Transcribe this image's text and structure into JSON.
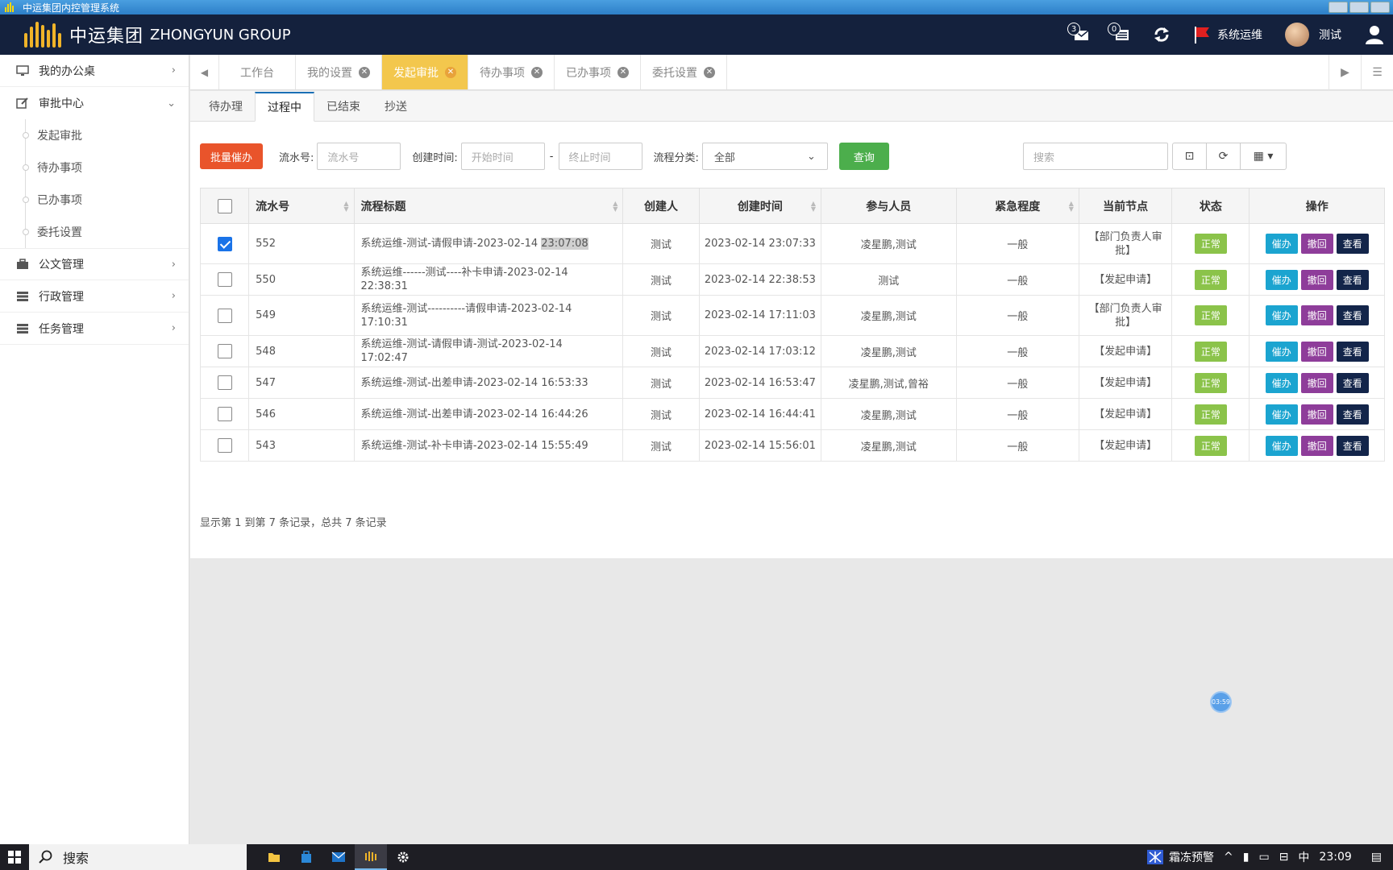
{
  "window": {
    "title": "中运集团内控管理系统"
  },
  "header": {
    "brand_cn": "中运集团",
    "brand_en": "ZHONGYUN GROUP",
    "msg_count": "3",
    "todo_count": "0",
    "role": "系统运维",
    "user": "测试"
  },
  "sidebar": {
    "items": [
      {
        "label": "我的办公桌"
      },
      {
        "label": "审批中心"
      },
      {
        "label": "公文管理"
      },
      {
        "label": "行政管理"
      },
      {
        "label": "任务管理"
      }
    ],
    "sub": [
      {
        "label": "发起审批"
      },
      {
        "label": "待办事项"
      },
      {
        "label": "已办事项"
      },
      {
        "label": "委托设置"
      }
    ]
  },
  "tabs": [
    {
      "label": "工作台"
    },
    {
      "label": "我的设置"
    },
    {
      "label": "发起审批"
    },
    {
      "label": "待办事项"
    },
    {
      "label": "已办事项"
    },
    {
      "label": "委托设置"
    }
  ],
  "subtabs": [
    {
      "label": "待办理"
    },
    {
      "label": "过程中"
    },
    {
      "label": "已结束"
    },
    {
      "label": "抄送"
    }
  ],
  "filter": {
    "batch_label": "批量催办",
    "serial_label": "流水号:",
    "serial_placeholder": "流水号",
    "created_label": "创建时间:",
    "start_placeholder": "开始时间",
    "sep": "-",
    "end_placeholder": "终止时间",
    "category_label": "流程分类:",
    "category_value": "全部",
    "query_label": "查询",
    "search_placeholder": "搜索"
  },
  "table": {
    "headers": [
      "流水号",
      "流程标题",
      "创建人",
      "创建时间",
      "参与人员",
      "紧急程度",
      "当前节点",
      "状态",
      "操作"
    ],
    "rows": [
      {
        "checked": true,
        "id": "552",
        "title": "系统运维-测试-请假申请-2023-02-14 ",
        "title_hl": "23:07:08",
        "creator": "测试",
        "time": "2023-02-14 23:07:33",
        "participants": "凌星鹏,测试",
        "urgency": "一般",
        "node": "【部门负责人审批】",
        "status": "正常"
      },
      {
        "checked": false,
        "id": "550",
        "title": "系统运维------测试----补卡申请-2023-02-14 22:38:31",
        "title_hl": "",
        "creator": "测试",
        "time": "2023-02-14 22:38:53",
        "participants": "测试",
        "urgency": "一般",
        "node": "【发起申请】",
        "status": "正常"
      },
      {
        "checked": false,
        "id": "549",
        "title": "系统运维-测试----------请假申请-2023-02-14 17:10:31",
        "title_hl": "",
        "creator": "测试",
        "time": "2023-02-14 17:11:03",
        "participants": "凌星鹏,测试",
        "urgency": "一般",
        "node": "【部门负责人审批】",
        "status": "正常"
      },
      {
        "checked": false,
        "id": "548",
        "title": "系统运维-测试-请假申请-测试-2023-02-14 17:02:47",
        "title_hl": "",
        "creator": "测试",
        "time": "2023-02-14 17:03:12",
        "participants": "凌星鹏,测试",
        "urgency": "一般",
        "node": "【发起申请】",
        "status": "正常"
      },
      {
        "checked": false,
        "id": "547",
        "title": "系统运维-测试-出差申请-2023-02-14 16:53:33",
        "title_hl": "",
        "creator": "测试",
        "time": "2023-02-14 16:53:47",
        "participants": "凌星鹏,测试,曾裕",
        "urgency": "一般",
        "node": "【发起申请】",
        "status": "正常"
      },
      {
        "checked": false,
        "id": "546",
        "title": "系统运维-测试-出差申请-2023-02-14 16:44:26",
        "title_hl": "",
        "creator": "测试",
        "time": "2023-02-14 16:44:41",
        "participants": "凌星鹏,测试",
        "urgency": "一般",
        "node": "【发起申请】",
        "status": "正常"
      },
      {
        "checked": false,
        "id": "543",
        "title": "系统运维-测试-补卡申请-2023-02-14 15:55:49",
        "title_hl": "",
        "creator": "测试",
        "time": "2023-02-14 15:56:01",
        "participants": "凌星鹏,测试",
        "urgency": "一般",
        "node": "【发起申请】",
        "status": "正常"
      }
    ],
    "actions": {
      "urge": "催办",
      "withdraw": "撤回",
      "view": "查看"
    }
  },
  "pagination": {
    "info": "显示第 1 到第 7 条记录，总共 7 条记录"
  },
  "float_timer": "03:59",
  "taskbar": {
    "search": "搜索",
    "weather": "霜冻预警",
    "ime": "中",
    "clock": "23:09"
  },
  "colors": {
    "header_bg": "#14213d",
    "active_tab": "#f3c74d",
    "batch_btn": "#e9542b",
    "query_btn": "#4cae4c",
    "status_ok": "#8bc34a",
    "urge": "#1ba4d0",
    "withdraw": "#8e3d9a",
    "view": "#13254a"
  }
}
